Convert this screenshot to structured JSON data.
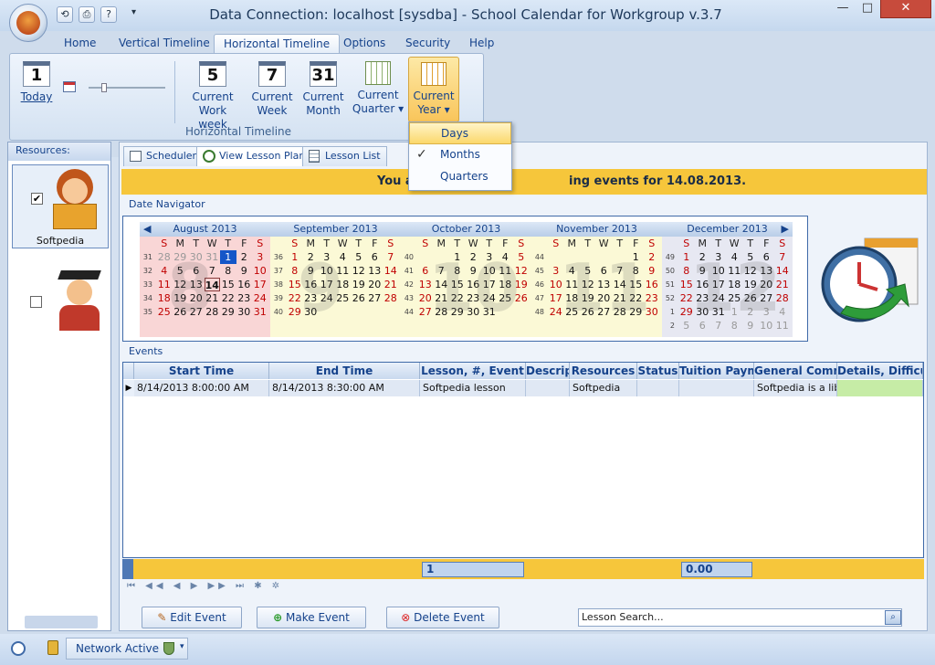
{
  "window": {
    "title": "Data Connection: localhost [sysdba] - School Calendar for Workgroup v.3.7",
    "minimize": "—",
    "maximize": "□",
    "close": "✕"
  },
  "menu": {
    "tabs": [
      "Home",
      "Vertical Timeline",
      "Horizontal Timeline",
      "Options",
      "Security",
      "Help"
    ],
    "active": "Horizontal Timeline"
  },
  "ribbon": {
    "today_num": "1",
    "today_label": "Today",
    "group_label": "Horizontal Timeline",
    "buttons": [
      {
        "num": "5",
        "line1": "Current",
        "line2": "Work week"
      },
      {
        "num": "7",
        "line1": "Current",
        "line2": "Week"
      },
      {
        "num": "31",
        "line1": "Current",
        "line2": "Month"
      },
      {
        "num": "",
        "line1": "Current",
        "line2": "Quarter ▾"
      },
      {
        "num": "",
        "line1": "Current",
        "line2": "Year ▾"
      }
    ]
  },
  "dropdown": {
    "items": [
      "Days",
      "Months",
      "Quarters"
    ],
    "checked": "✓"
  },
  "resources": {
    "header": "Resources:",
    "items": [
      {
        "name": "Softpedia",
        "checked": "✔"
      },
      {
        "name": "",
        "checked": ""
      }
    ]
  },
  "subtabs": [
    "Scheduler",
    "View Lesson Plans",
    "Lesson List"
  ],
  "banner": {
    "left": "You a",
    "right": "ing events for 14.08.2013."
  },
  "date_navigator": {
    "label": "Date Navigator",
    "day_headers": [
      "S",
      "M",
      "T",
      "W",
      "T",
      "F",
      "S"
    ],
    "months": [
      {
        "name": "August 2013",
        "big": "8",
        "weeks": [
          "31",
          "32",
          "33",
          "34",
          "35"
        ],
        "rows": [
          [
            "28",
            "29",
            "30",
            "31",
            "1",
            "2",
            "3"
          ],
          [
            "4",
            "5",
            "6",
            "7",
            "8",
            "9",
            "10"
          ],
          [
            "11",
            "12",
            "13",
            "14",
            "15",
            "16",
            "17"
          ],
          [
            "18",
            "19",
            "20",
            "21",
            "22",
            "23",
            "24"
          ],
          [
            "25",
            "26",
            "27",
            "28",
            "29",
            "30",
            "31"
          ]
        ]
      },
      {
        "name": "September 2013",
        "big": "9",
        "weeks": [
          "36",
          "37",
          "38",
          "39",
          "40"
        ],
        "rows": [
          [
            "1",
            "2",
            "3",
            "4",
            "5",
            "6",
            "7"
          ],
          [
            "8",
            "9",
            "10",
            "11",
            "12",
            "13",
            "14"
          ],
          [
            "15",
            "16",
            "17",
            "18",
            "19",
            "20",
            "21"
          ],
          [
            "22",
            "23",
            "24",
            "25",
            "26",
            "27",
            "28"
          ],
          [
            "29",
            "30",
            "",
            "",
            "",
            "",
            ""
          ]
        ]
      },
      {
        "name": "October 2013",
        "big": "10",
        "weeks": [
          "40",
          "41",
          "42",
          "43",
          "44"
        ],
        "rows": [
          [
            "",
            "",
            "1",
            "2",
            "3",
            "4",
            "5"
          ],
          [
            "6",
            "7",
            "8",
            "9",
            "10",
            "11",
            "12"
          ],
          [
            "13",
            "14",
            "15",
            "16",
            "17",
            "18",
            "19"
          ],
          [
            "20",
            "21",
            "22",
            "23",
            "24",
            "25",
            "26"
          ],
          [
            "27",
            "28",
            "29",
            "30",
            "31",
            "",
            ""
          ]
        ]
      },
      {
        "name": "November 2013",
        "big": "11",
        "weeks": [
          "44",
          "45",
          "46",
          "47",
          "48"
        ],
        "rows": [
          [
            "",
            "",
            "",
            "",
            "",
            "1",
            "2"
          ],
          [
            "3",
            "4",
            "5",
            "6",
            "7",
            "8",
            "9"
          ],
          [
            "10",
            "11",
            "12",
            "13",
            "14",
            "15",
            "16"
          ],
          [
            "17",
            "18",
            "19",
            "20",
            "21",
            "22",
            "23"
          ],
          [
            "24",
            "25",
            "26",
            "27",
            "28",
            "29",
            "30"
          ]
        ]
      },
      {
        "name": "December 2013",
        "big": "12",
        "weeks": [
          "49",
          "50",
          "51",
          "52",
          "1",
          "2"
        ],
        "rows": [
          [
            "1",
            "2",
            "3",
            "4",
            "5",
            "6",
            "7"
          ],
          [
            "8",
            "9",
            "10",
            "11",
            "12",
            "13",
            "14"
          ],
          [
            "15",
            "16",
            "17",
            "18",
            "19",
            "20",
            "21"
          ],
          [
            "22",
            "23",
            "24",
            "25",
            "26",
            "27",
            "28"
          ],
          [
            "29",
            "30",
            "31",
            "1",
            "2",
            "3",
            "4"
          ],
          [
            "5",
            "6",
            "7",
            "8",
            "9",
            "10",
            "11"
          ]
        ]
      }
    ]
  },
  "events": {
    "label": "Events",
    "columns": [
      "Start Time",
      "End Time",
      "Lesson, #, Event",
      "Descrip",
      "Resources",
      "Status",
      "Tuition Payme",
      "General Comme",
      "Details, Difficul"
    ],
    "rows": [
      [
        "8/14/2013 8:00:00 AM",
        "8/14/2013 8:30:00 AM",
        "Softpedia lesson",
        "",
        "Softpedia",
        "",
        "",
        "Softpedia is a libra",
        ""
      ]
    ],
    "summary_count": "1",
    "summary_total": "0.00",
    "nav": "⏮ ◀◀ ◀ ▶ ▶▶ ⏭ ✱ ✲"
  },
  "buttons": {
    "edit": "Edit Event",
    "make": "Make Event",
    "delete": "Delete Event"
  },
  "search": {
    "placeholder": "Lesson Search..."
  },
  "status": {
    "network": "Network Active"
  }
}
